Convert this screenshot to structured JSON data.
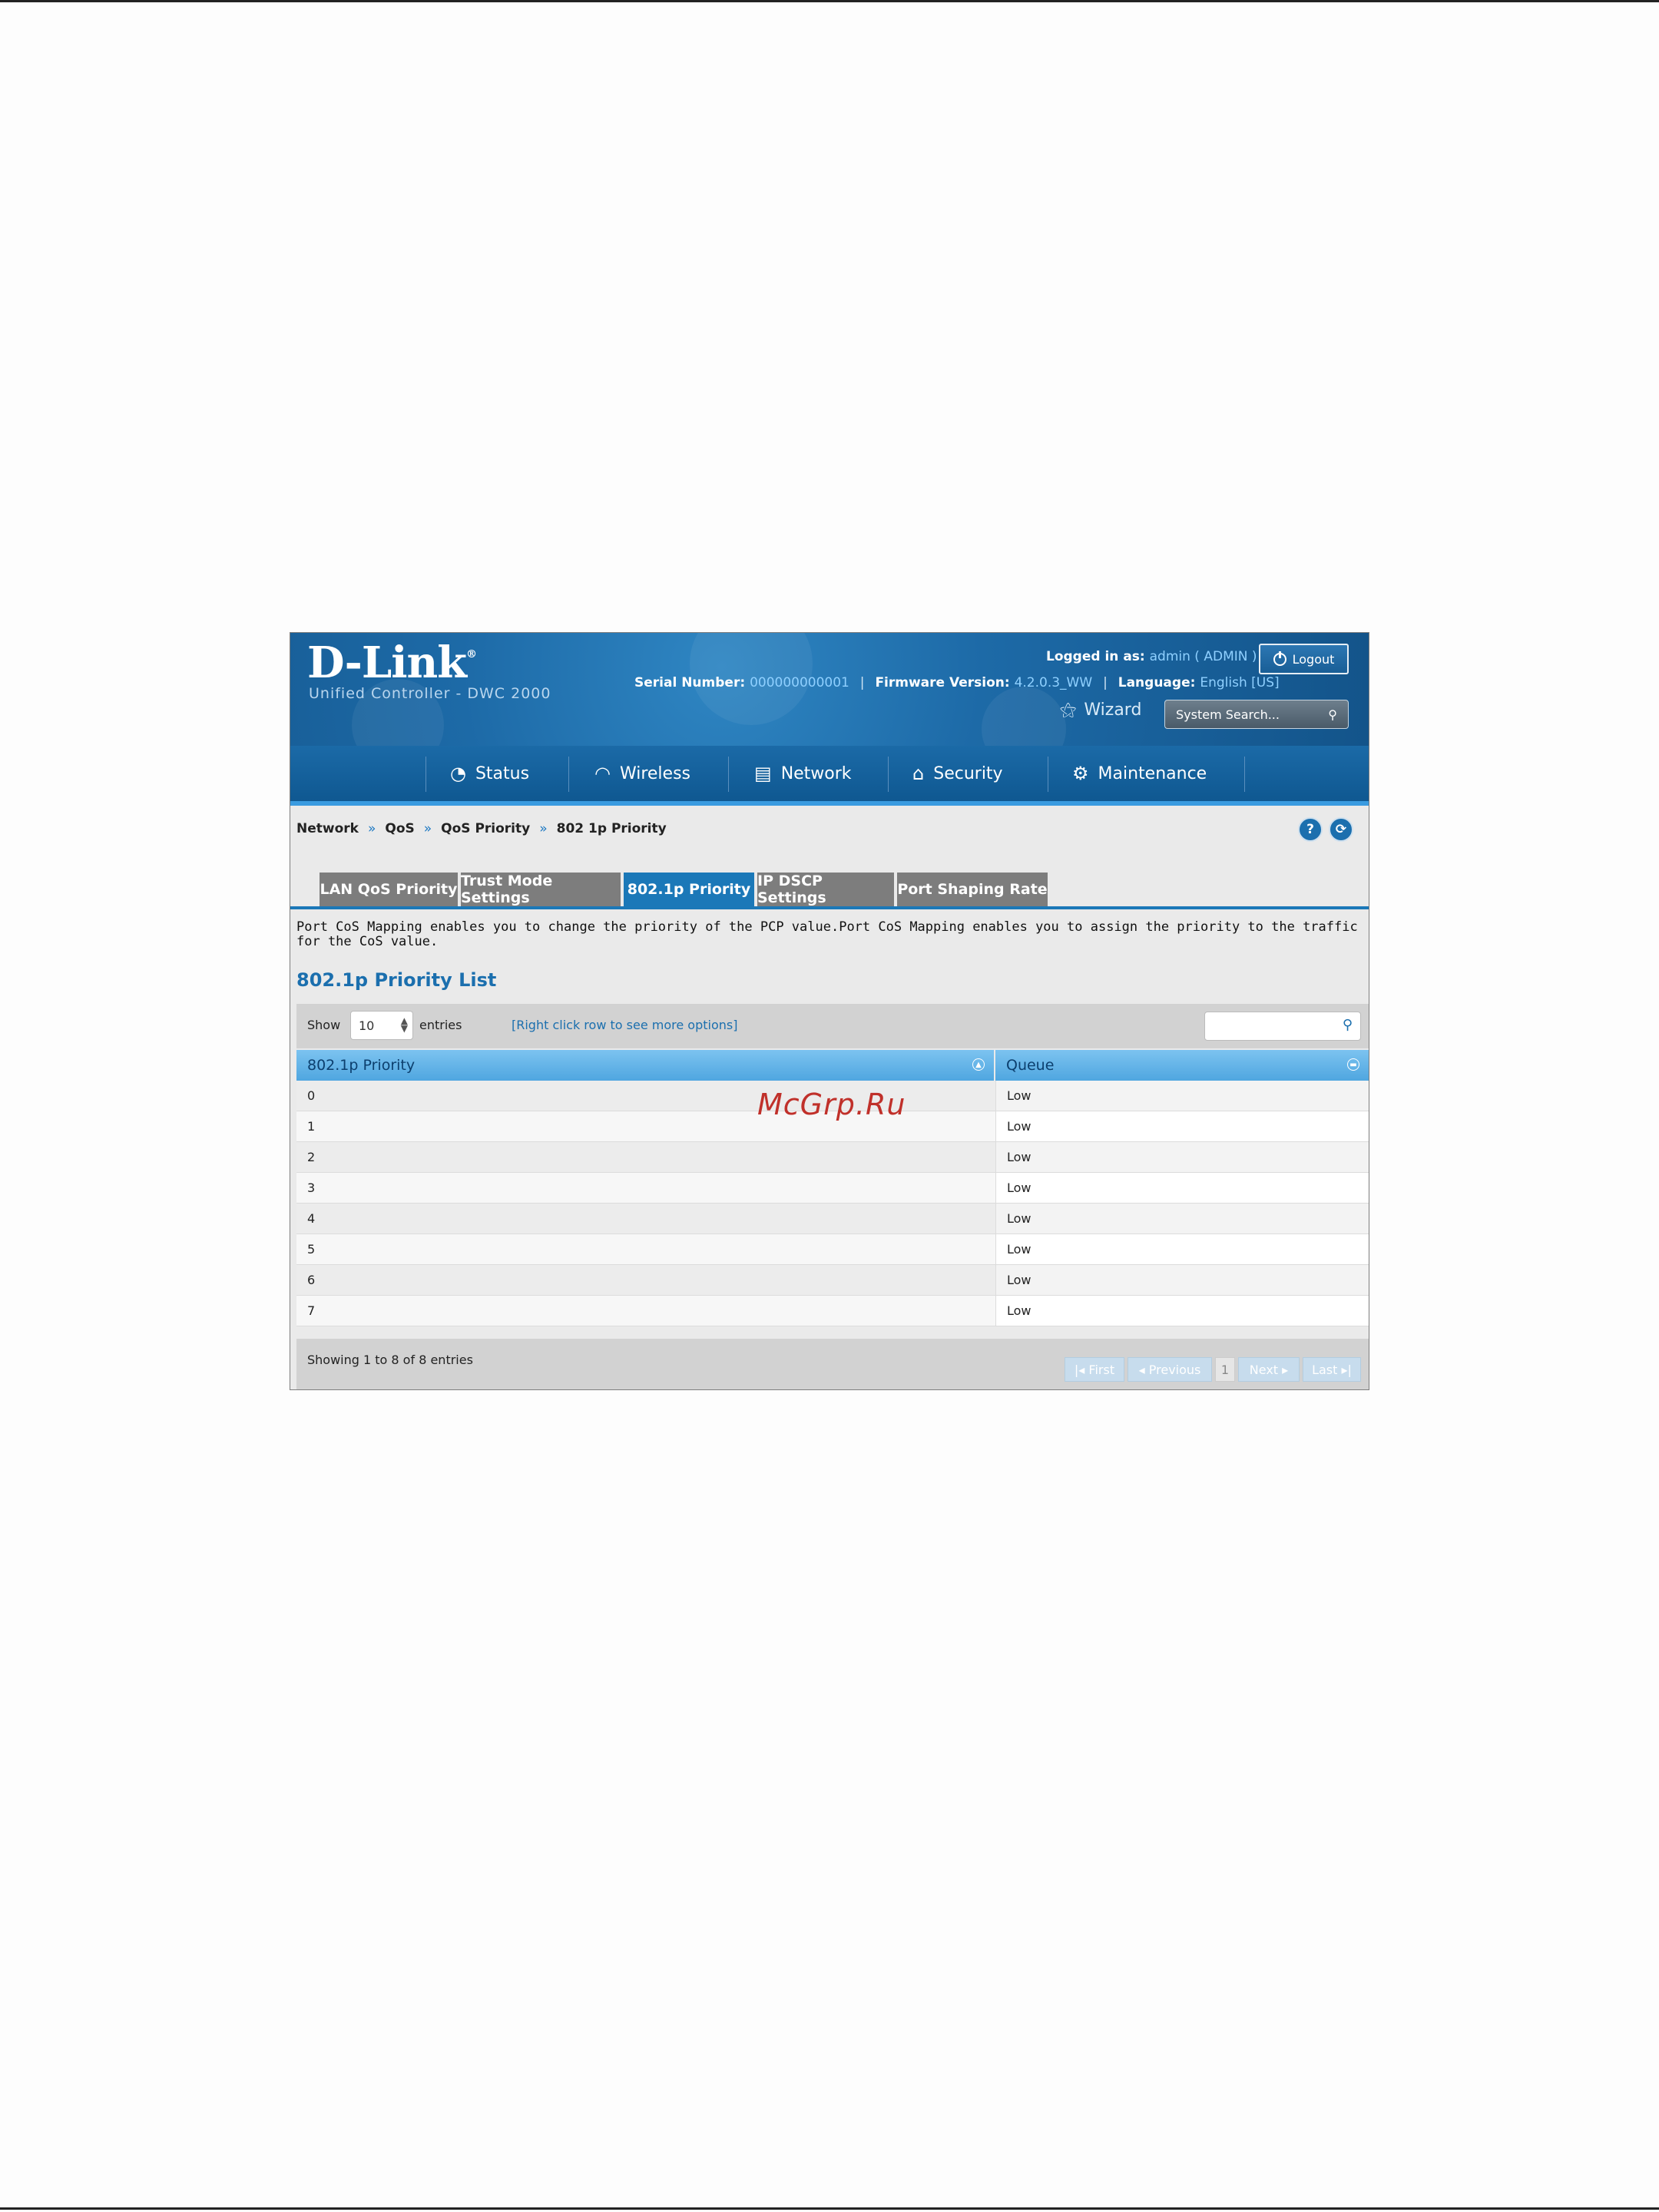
{
  "header": {
    "logo": "D-Link",
    "logo_mark": "®",
    "subtitle": "Unified Controller - DWC 2000",
    "logged_in_label": "Logged in as:",
    "logged_in_user": "admin ( ADMIN )",
    "logout_label": "Logout",
    "serial_label": "Serial Number:",
    "serial_value": "000000000001",
    "firmware_label": "Firmware Version:",
    "firmware_value": "4.2.0.3_WW",
    "language_label": "Language:",
    "language_value": "English [US]",
    "wizard_label": "Wizard",
    "search_placeholder": "System Search..."
  },
  "nav": {
    "items": [
      {
        "label": "Status",
        "icon": "gauge-icon"
      },
      {
        "label": "Wireless",
        "icon": "wifi-icon"
      },
      {
        "label": "Network",
        "icon": "server-icon"
      },
      {
        "label": "Security",
        "icon": "lock-icon"
      },
      {
        "label": "Maintenance",
        "icon": "gears-icon"
      }
    ]
  },
  "breadcrumb": [
    "Network",
    "QoS",
    "QoS Priority",
    "802 1p Priority"
  ],
  "breadcrumb_sep": "»",
  "help_icons": [
    "?",
    "⟳"
  ],
  "tabs": [
    {
      "label": "LAN QoS Priority",
      "active": false
    },
    {
      "label": "Trust Mode Settings",
      "active": false
    },
    {
      "label": "802.1p Priority",
      "active": true
    },
    {
      "label": "IP DSCP Settings",
      "active": false
    },
    {
      "label": "Port Shaping Rate",
      "active": false
    }
  ],
  "description": "Port CoS Mapping enables you to change the priority of the PCP value.Port CoS Mapping enables you to assign the priority to the traffic for the CoS value.",
  "list_title": "802.1p Priority List",
  "toolbar": {
    "show_label": "Show",
    "entries_value": "10",
    "entries_label": "entries",
    "hint": "[Right click row to see more options]"
  },
  "table": {
    "columns": [
      "802.1p Priority",
      "Queue"
    ],
    "rows": [
      [
        "0",
        "Low"
      ],
      [
        "1",
        "Low"
      ],
      [
        "2",
        "Low"
      ],
      [
        "3",
        "Low"
      ],
      [
        "4",
        "Low"
      ],
      [
        "5",
        "Low"
      ],
      [
        "6",
        "Low"
      ],
      [
        "7",
        "Low"
      ]
    ]
  },
  "footer": {
    "showing": "Showing 1 to 8 of 8 entries",
    "first": "First",
    "previous": "Previous",
    "page": "1",
    "next": "Next",
    "last": "Last"
  },
  "watermark": "McGrp.Ru"
}
